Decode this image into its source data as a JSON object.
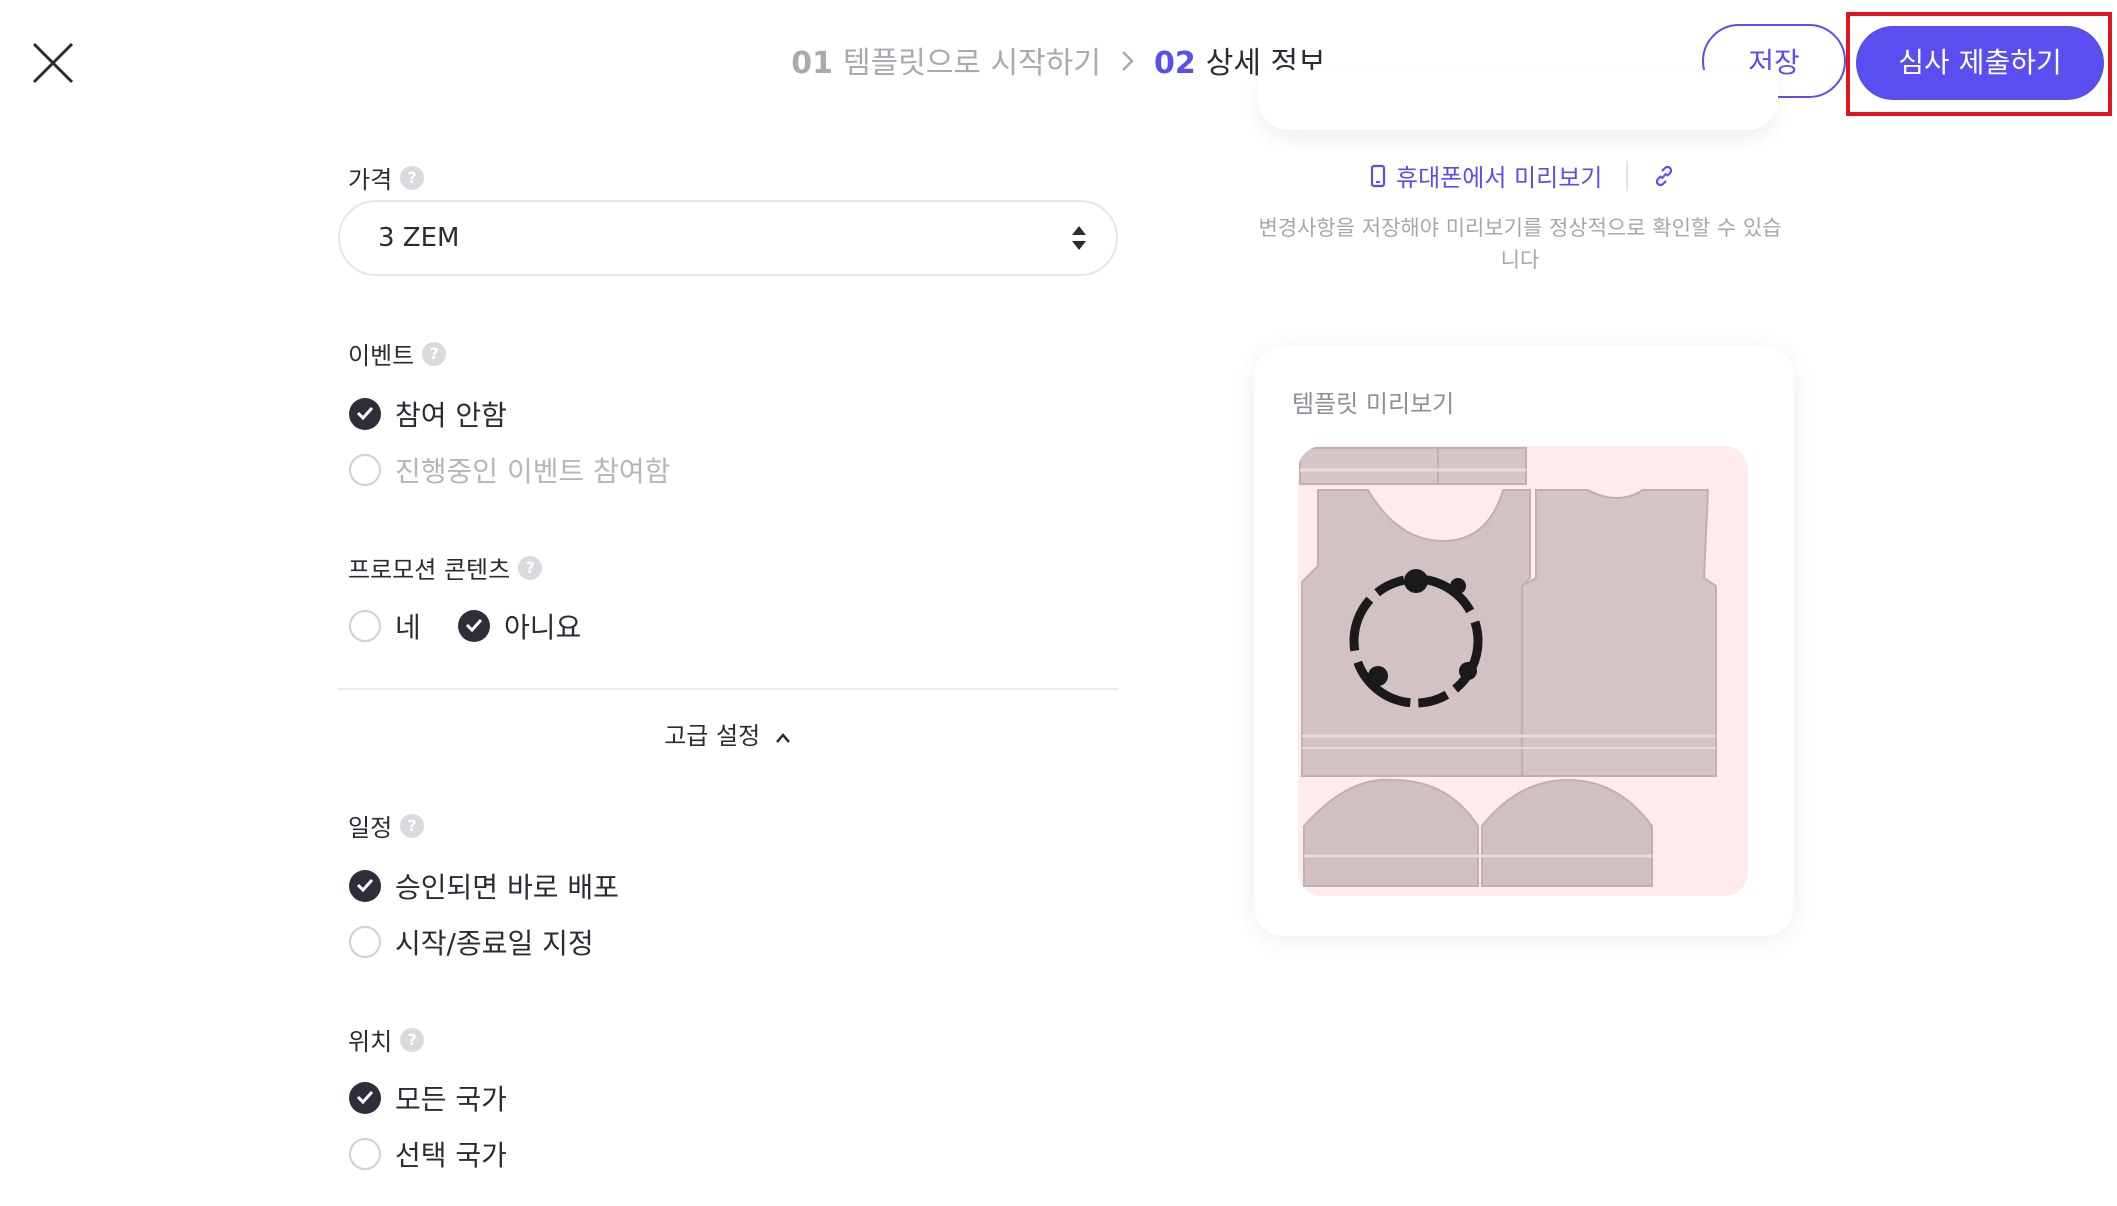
{
  "header": {
    "step1_num": "01",
    "step1_label": "템플릿으로 시작하기",
    "step2_num": "02",
    "step2_label": "상세 정보",
    "save_label": "저장",
    "submit_label": "심사 제출하기"
  },
  "form": {
    "price": {
      "label": "가격",
      "value": "3 ZEM"
    },
    "event": {
      "label": "이벤트",
      "options": [
        "참여 안함",
        "진행중인 이벤트 참여함"
      ],
      "selected": "참여 안함"
    },
    "promotion": {
      "label": "프로모션 콘텐츠",
      "options": [
        "네",
        "아니요"
      ],
      "selected": "아니요"
    },
    "advanced_label": "고급 설정",
    "schedule": {
      "label": "일정",
      "options": [
        "승인되면 바로 배포",
        "시작/종료일 지정"
      ],
      "selected": "승인되면 바로 배포"
    },
    "location": {
      "label": "위치",
      "options": [
        "모든 국가",
        "선택 국가"
      ],
      "selected": "모든 국가"
    }
  },
  "preview": {
    "mobile_preview_label": "휴대폰에서 미리보기",
    "notice": "변경사항을 저장해야 미리보기를 정상적으로 확인할 수 있습니다",
    "template_preview_title": "템플릿 미리보기"
  },
  "colors": {
    "accent": "#5b4ef0",
    "highlight": "#e0151e",
    "checked": "#2e2e3a"
  }
}
